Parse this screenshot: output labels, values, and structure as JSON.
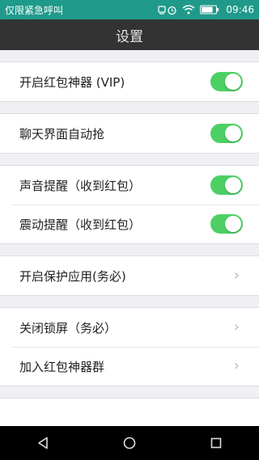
{
  "status_bar": {
    "carrier": "仅限紧急呼叫",
    "battery_level": 0.8,
    "time": "09:46",
    "icons": [
      "notification-icon",
      "alarm-icon",
      "wifi-icon",
      "battery-icon"
    ]
  },
  "title_bar": {
    "title": "设置"
  },
  "settings": {
    "groups": [
      {
        "rows": [
          {
            "label": "开启红包神器 (VIP)",
            "control": "toggle",
            "on": true
          }
        ]
      },
      {
        "rows": [
          {
            "label": "聊天界面自动抢",
            "control": "toggle",
            "on": true
          }
        ]
      },
      {
        "rows": [
          {
            "label": "声音提醒（收到红包）",
            "control": "toggle",
            "on": true
          },
          {
            "label": "震动提醒（收到红包）",
            "control": "toggle",
            "on": true
          }
        ]
      },
      {
        "rows": [
          {
            "label": "开启保护应用(务必)",
            "control": "chevron"
          }
        ]
      },
      {
        "rows": [
          {
            "label": "关闭锁屏（务必）",
            "control": "chevron"
          },
          {
            "label": "加入红包神器群",
            "control": "chevron"
          }
        ]
      }
    ]
  },
  "colors": {
    "status_bar": "#1f9a8a",
    "title_bar": "#333333",
    "toggle_on": "#4cd064",
    "background": "#efeff4"
  },
  "nav_bar": {
    "icons": [
      "back-icon",
      "home-icon",
      "recents-icon"
    ]
  }
}
